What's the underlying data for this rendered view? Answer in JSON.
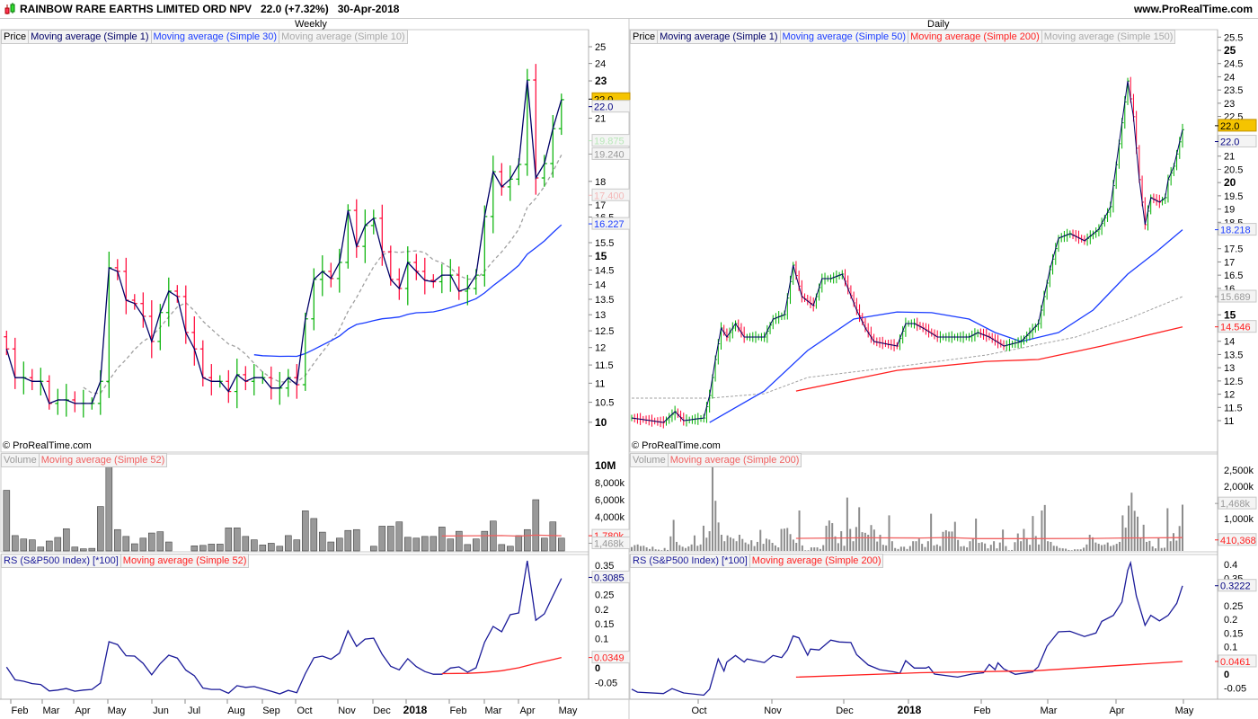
{
  "header": {
    "title": "RAINBOW RARE EARTHS LIMITED ORD NPV   22.0 (+7.32%)   30-Apr-2018",
    "site": "www.ProRealTime.com",
    "copyright": "© ProRealTime.com"
  },
  "colors": {
    "up": "#00b000",
    "down": "#ff0033",
    "close_line": "#000066",
    "ma_blue": "#1a3cff",
    "ma_grey": "#a0a0a0",
    "ma_red": "#ff2020",
    "volume": "#8c8c8c",
    "rs": "#1a1a99",
    "last_price_bg": "#f5c400"
  },
  "weekly": {
    "timeframe": "Weekly",
    "legend": [
      "Price",
      "Moving average (Simple 1)",
      "Moving average (Simple 30)",
      "Moving average (Simple 10)"
    ],
    "volume_legend": [
      "Volume",
      "Moving average (Simple 52)"
    ],
    "rs_legend": [
      "RS (S&P500 Index) [*100]",
      "Moving average (Simple 52)"
    ],
    "x_labels": [
      "Feb",
      "Mar",
      "Apr",
      "May",
      "Jun",
      "Jul",
      "Aug",
      "Sep",
      "Oct",
      "Nov",
      "Dec",
      "2018",
      "Feb",
      "Mar",
      "Apr",
      "May"
    ],
    "price_ticks": [
      "25",
      "24",
      "23",
      "21",
      "18",
      "17",
      "16.5",
      "15.5",
      "15",
      "14.5",
      "14",
      "13.5",
      "13",
      "12.5",
      "12",
      "11.5",
      "11",
      "10.5",
      "10"
    ],
    "price_bold": [
      "23",
      "15",
      "10"
    ],
    "price_tags": [
      {
        "label": "22.0",
        "style": "last",
        "value": 22.0
      },
      {
        "label": "22.0",
        "style": "navy",
        "value": 21.6
      },
      {
        "label": "19.875",
        "style": "green",
        "value": 19.875
      },
      {
        "label": "19.240",
        "style": "grey",
        "value": 19.24
      },
      {
        "label": "17.400",
        "style": "pink",
        "value": 17.4
      },
      {
        "label": "16.227",
        "style": "blue",
        "value": 16.227
      }
    ],
    "closes": [
      11.96,
      11.15,
      11.15,
      11.05,
      11.05,
      10.47,
      10.56,
      10.56,
      10.47,
      10.47,
      10.47,
      11.05,
      14.58,
      14.45,
      13.47,
      13.36,
      12.95,
      12.18,
      13.07,
      13.77,
      13.59,
      12.45,
      11.96,
      11.15,
      11.05,
      11.05,
      10.78,
      11.23,
      11.05,
      11.15,
      11.15,
      10.87,
      10.87,
      11.15,
      10.96,
      12.87,
      14.17,
      14.45,
      14.2,
      14.77,
      16.77,
      15.36,
      16.16,
      16.45,
      15.16,
      14.17,
      13.86,
      14.77,
      14.45,
      14.14,
      14.09,
      14.32,
      14.32,
      13.77,
      13.86,
      14.32,
      16.52,
      18.43,
      17.76,
      18.1,
      18.76,
      23.05,
      18.15,
      18.8,
      20.47,
      21.97
    ],
    "volume_ticks": [
      "10M",
      "8,000k",
      "6,000k",
      "4,000k"
    ],
    "volume_tags": [
      {
        "label": "1,780k",
        "style": "red",
        "value": 1.78
      },
      {
        "label": "1,468k",
        "style": "grey",
        "value": 0.9
      }
    ],
    "volume_millions": [
      7.1,
      1.8,
      1.4,
      1.3,
      0.46,
      1.16,
      1.58,
      2.6,
      0.46,
      0.25,
      0.3,
      5.2,
      10,
      2.5,
      1.7,
      0.84,
      1.5,
      2.1,
      2.25,
      1.05,
      0,
      0,
      0.6,
      0.65,
      0.8,
      0.8,
      2.7,
      2.7,
      1.7,
      1.3,
      0.7,
      0.9,
      0.55,
      1.8,
      1.3,
      4.7,
      3.8,
      2.2,
      1.05,
      1.5,
      2.4,
      2.5,
      0,
      0.55,
      2.9,
      2.9,
      3.4,
      1.6,
      1.5,
      1.7,
      1.7,
      2.8,
      1.4,
      2.3,
      0.75,
      1.4,
      2.3,
      3.5,
      0.75,
      0.55,
      1.8,
      2.5,
      6.0,
      1.5,
      3.4,
      1.5
    ],
    "volume_ma52": [
      [
        51,
        1.75
      ],
      [
        55,
        1.78
      ],
      [
        58,
        1.8
      ],
      [
        60,
        1.74
      ],
      [
        62,
        1.85
      ],
      [
        65,
        1.78
      ]
    ],
    "rs_ticks": [
      "0.35",
      "0.25",
      "0.2",
      "0.15",
      "0.1",
      "0",
      "-0.05"
    ],
    "rs_tags": [
      {
        "label": "0.3085",
        "style": "navy",
        "value": 0.3085
      },
      {
        "label": "0.0349",
        "style": "red",
        "value": 0.0349
      }
    ],
    "rs": [
      0.002,
      -0.041,
      -0.046,
      -0.054,
      -0.057,
      -0.079,
      -0.076,
      -0.071,
      -0.08,
      -0.076,
      -0.074,
      -0.052,
      0.089,
      0.079,
      0.041,
      0.04,
      0.015,
      -0.024,
      0.014,
      0.043,
      0.033,
      -0.008,
      -0.027,
      -0.069,
      -0.074,
      -0.074,
      -0.087,
      -0.061,
      -0.067,
      -0.064,
      -0.072,
      -0.08,
      -0.089,
      -0.077,
      -0.085,
      -0.02,
      0.034,
      0.04,
      0.029,
      0.05,
      0.126,
      0.073,
      0.098,
      0.101,
      0.046,
      0.005,
      -0.007,
      0.031,
      0.004,
      -0.013,
      -0.022,
      -0.022,
      -0.001,
      0.003,
      -0.015,
      0,
      0.087,
      0.141,
      0.123,
      0.181,
      0.187,
      0.365,
      0.162,
      0.184,
      0.245,
      0.305
    ],
    "rs_ma52": [
      [
        51,
        -0.02
      ],
      [
        54,
        -0.019
      ],
      [
        56,
        -0.016
      ],
      [
        58,
        -0.01
      ],
      [
        60,
        0.0
      ],
      [
        62,
        0.015
      ],
      [
        64,
        0.028
      ],
      [
        65,
        0.035
      ]
    ]
  },
  "daily": {
    "timeframe": "Daily",
    "legend": [
      "Price",
      "Moving average (Simple 1)",
      "Moving average (Simple 50)",
      "Moving average (Simple 200)",
      "Moving average (Simple 150)"
    ],
    "volume_legend": [
      "Volume",
      "Moving average (Simple 200)"
    ],
    "rs_legend": [
      "RS (S&P500 Index) [*100]",
      "Moving average (Simple 200)"
    ],
    "x_labels": [
      "Oct",
      "Nov",
      "Dec",
      "2018",
      "Feb",
      "Mar",
      "Apr",
      "May"
    ],
    "price_ticks": [
      "25.5",
      "25",
      "24.5",
      "24",
      "23.5",
      "23",
      "22.5",
      "21",
      "20.5",
      "20",
      "19.5",
      "19",
      "18.5",
      "17.5",
      "17",
      "16.5",
      "16",
      "15",
      "14",
      "13.5",
      "13",
      "12.5",
      "12",
      "11.5",
      "11"
    ],
    "price_bold": [
      "25",
      "20",
      "15"
    ],
    "price_tags": [
      {
        "label": "22.0",
        "style": "last",
        "value": 22.15
      },
      {
        "label": "22.0",
        "style": "navy",
        "value": 21.55
      },
      {
        "label": "18.218",
        "style": "blue",
        "value": 18.218
      },
      {
        "label": "15.689",
        "style": "grey",
        "value": 15.689
      },
      {
        "label": "14.546",
        "style": "red",
        "value": 14.546
      }
    ],
    "close_keypoints": [
      [
        0,
        11.1
      ],
      [
        11,
        10.93
      ],
      [
        15,
        11.34
      ],
      [
        18,
        11.0
      ],
      [
        25,
        11.1
      ],
      [
        27,
        11.95
      ],
      [
        29,
        13.31
      ],
      [
        31,
        14.5
      ],
      [
        33,
        14.16
      ],
      [
        36,
        14.67
      ],
      [
        39,
        14.16
      ],
      [
        46,
        14.16
      ],
      [
        49,
        14.84
      ],
      [
        53,
        15.01
      ],
      [
        56,
        16.88
      ],
      [
        59,
        15.69
      ],
      [
        63,
        15.35
      ],
      [
        66,
        16.37
      ],
      [
        69,
        16.37
      ],
      [
        73,
        16.54
      ],
      [
        78,
        15.18
      ],
      [
        81,
        14.5
      ],
      [
        84,
        13.99
      ],
      [
        92,
        13.82
      ],
      [
        95,
        14.67
      ],
      [
        98,
        14.67
      ],
      [
        101,
        14.5
      ],
      [
        106,
        14.16
      ],
      [
        117,
        14.16
      ],
      [
        120,
        14.33
      ],
      [
        124,
        14.16
      ],
      [
        129,
        13.82
      ],
      [
        135,
        13.99
      ],
      [
        141,
        14.67
      ],
      [
        145,
        16.71
      ],
      [
        148,
        17.9
      ],
      [
        152,
        18.07
      ],
      [
        157,
        17.8
      ],
      [
        162,
        18.24
      ],
      [
        166,
        19.09
      ],
      [
        169,
        21.47
      ],
      [
        172,
        23.84
      ],
      [
        174,
        22.49
      ],
      [
        176,
        20.11
      ],
      [
        178,
        18.41
      ],
      [
        180,
        19.43
      ],
      [
        183,
        19.26
      ],
      [
        185,
        19.43
      ],
      [
        186,
        20.11
      ],
      [
        188,
        20.62
      ],
      [
        191,
        22.0
      ]
    ],
    "ma50_keypoints": [
      [
        27,
        10.93
      ],
      [
        46,
        12.12
      ],
      [
        61,
        13.65
      ],
      [
        77,
        14.84
      ],
      [
        92,
        15.11
      ],
      [
        104,
        15.08
      ],
      [
        117,
        14.84
      ],
      [
        126,
        14.33
      ],
      [
        135,
        13.99
      ],
      [
        148,
        14.33
      ],
      [
        160,
        15.18
      ],
      [
        172,
        16.54
      ],
      [
        182,
        17.39
      ],
      [
        191,
        18.218
      ]
    ],
    "ma200_keypoints": [
      [
        57,
        12.12
      ],
      [
        92,
        12.9
      ],
      [
        123,
        13.24
      ],
      [
        141,
        13.31
      ],
      [
        163,
        13.82
      ],
      [
        191,
        14.546
      ]
    ],
    "ma150_keypoints": [
      [
        0,
        11.85
      ],
      [
        27,
        11.85
      ],
      [
        46,
        12.02
      ],
      [
        61,
        12.63
      ],
      [
        92,
        13.04
      ],
      [
        123,
        13.48
      ],
      [
        154,
        14.16
      ],
      [
        172,
        14.84
      ],
      [
        191,
        15.689
      ]
    ],
    "volume_ticks": [
      "2,500k",
      "2,000k",
      "1,000k"
    ],
    "volume_tags": [
      {
        "label": "1,468k",
        "style": "grey",
        "value": 1468
      },
      {
        "label": "410,368",
        "style": "red",
        "value": 340
      }
    ],
    "volume_k": [
      120,
      180,
      200,
      150,
      160,
      110,
      60,
      130,
      50,
      40,
      20,
      90,
      30,
      450,
      960,
      280,
      180,
      130,
      90,
      140,
      200,
      480,
      160,
      200,
      780,
      410,
      610,
      2650,
      1550,
      880,
      500,
      300,
      480,
      420,
      380,
      300,
      500,
      370,
      260,
      210,
      330,
      150,
      280,
      650,
      220,
      380,
      350,
      250,
      170,
      110,
      680,
      690,
      710,
      520,
      350,
      250,
      1250,
      170,
      20,
      20,
      110,
      110,
      110,
      60,
      180,
      780,
      940,
      860,
      450,
      240,
      610,
      160,
      1650,
      680,
      300,
      740,
      1350,
      580,
      560,
      500,
      800,
      660,
      290,
      500,
      190,
      170,
      1100,
      300,
      90,
      60,
      130,
      130,
      60,
      150,
      300,
      300,
      380,
      220,
      120,
      300,
      1150,
      170,
      200,
      150,
      590,
      640,
      600,
      600,
      900,
      340,
      140,
      150,
      110,
      300,
      390,
      1000,
      250,
      270,
      230,
      80,
      190,
      300,
      80,
      260,
      660,
      150,
      20,
      30,
      270,
      540,
      300,
      680,
      400,
      190,
      1080,
      460,
      200,
      1250,
      1420,
      300,
      280,
      160,
      150,
      90,
      80,
      70,
      30,
      20,
      50,
      50,
      50,
      100,
      200,
      500,
      420,
      260,
      220,
      180,
      200,
      260,
      150,
      180,
      220,
      280,
      1100,
      720,
      1400,
      1800,
      1240,
      1060,
      420,
      810,
      280,
      310,
      140,
      80,
      400,
      90,
      100,
      1320,
      300,
      550,
      320,
      770,
      1430
    ],
    "volume_ma200_keypoints": [
      [
        57,
        390
      ],
      [
        80,
        405
      ],
      [
        100,
        400
      ],
      [
        110,
        415
      ],
      [
        120,
        380
      ],
      [
        140,
        380
      ],
      [
        160,
        385
      ],
      [
        170,
        400
      ],
      [
        191,
        410
      ]
    ],
    "rs_ticks": [
      "0.4",
      "0.35",
      "0.25",
      "0.2",
      "0.15",
      "0.1",
      "0",
      "-0.05"
    ],
    "rs_tags": [
      {
        "label": "0.3222",
        "style": "navy",
        "value": 0.3222
      },
      {
        "label": "0.0461",
        "style": "red",
        "value": 0.0461
      }
    ],
    "rs_keypoints": [
      [
        0,
        -0.055
      ],
      [
        2,
        -0.066
      ],
      [
        11,
        -0.071
      ],
      [
        14,
        -0.053
      ],
      [
        18,
        -0.069
      ],
      [
        25,
        -0.077
      ],
      [
        27,
        -0.055
      ],
      [
        30,
        0.055
      ],
      [
        32,
        0.011
      ],
      [
        33,
        0.044
      ],
      [
        36,
        0.068
      ],
      [
        39,
        0.044
      ],
      [
        40,
        0.055
      ],
      [
        46,
        0.042
      ],
      [
        49,
        0.068
      ],
      [
        52,
        0.06
      ],
      [
        54,
        0.088
      ],
      [
        56,
        0.139
      ],
      [
        58,
        0.132
      ],
      [
        61,
        0.069
      ],
      [
        62,
        0.091
      ],
      [
        65,
        0.088
      ],
      [
        69,
        0.124
      ],
      [
        72,
        0.117
      ],
      [
        76,
        0.115
      ],
      [
        78,
        0.071
      ],
      [
        82,
        0.033
      ],
      [
        86,
        0.016
      ],
      [
        91,
        0.008
      ],
      [
        93,
        0.003
      ],
      [
        95,
        0.049
      ],
      [
        98,
        0.022
      ],
      [
        102,
        0.022
      ],
      [
        103,
        0.027
      ],
      [
        105,
        0
      ],
      [
        113,
        -0.011
      ],
      [
        118,
        0
      ],
      [
        122,
        0.005
      ],
      [
        124,
        0.035
      ],
      [
        126,
        0.016
      ],
      [
        127,
        0.041
      ],
      [
        129,
        0.019
      ],
      [
        133,
        -0.001
      ],
      [
        139,
        0.008
      ],
      [
        141,
        0.027
      ],
      [
        144,
        0.102
      ],
      [
        148,
        0.154
      ],
      [
        152,
        0.156
      ],
      [
        157,
        0.137
      ],
      [
        161,
        0.15
      ],
      [
        163,
        0.192
      ],
      [
        167,
        0.214
      ],
      [
        170,
        0.263
      ],
      [
        172,
        0.378
      ],
      [
        173,
        0.406
      ],
      [
        175,
        0.285
      ],
      [
        178,
        0.178
      ],
      [
        180,
        0.214
      ],
      [
        183,
        0.194
      ],
      [
        186,
        0.214
      ],
      [
        189,
        0.258
      ],
      [
        191,
        0.322
      ]
    ],
    "rs_ma200_keypoints": [
      [
        57,
        -0.011
      ],
      [
        100,
        0.005
      ],
      [
        140,
        0.012
      ],
      [
        191,
        0.046
      ]
    ]
  }
}
